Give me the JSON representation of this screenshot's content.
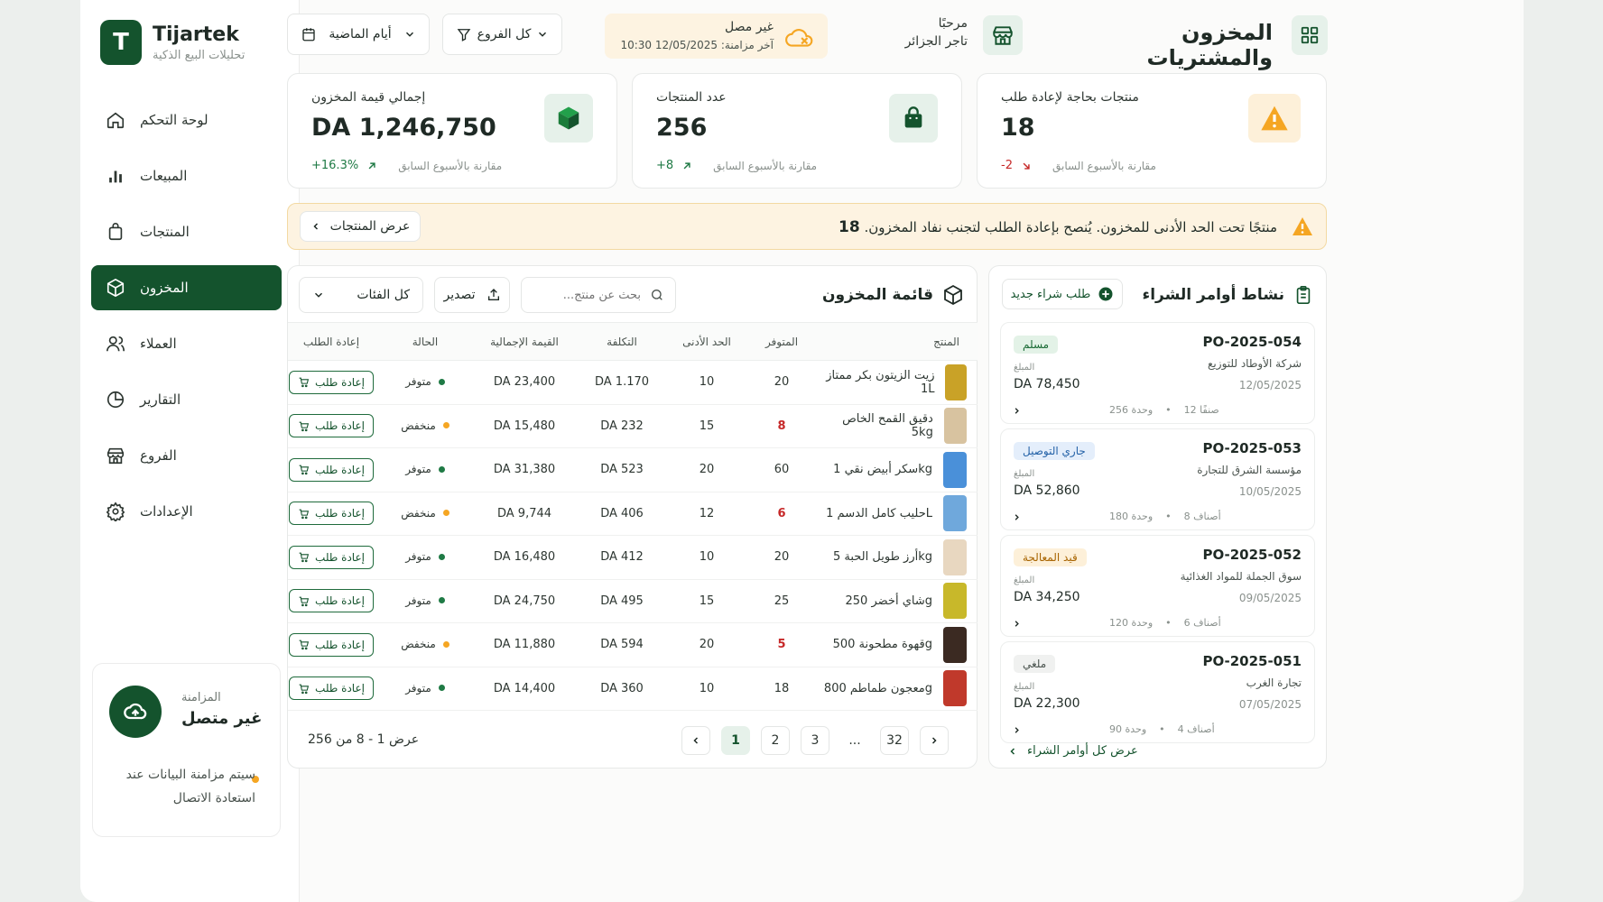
{
  "brand": {
    "name": "Tijartek",
    "tagline": "تحليلات البيع الذكية",
    "mark": "T"
  },
  "nav": [
    {
      "label": "لوحة التحكم",
      "icon": "home-icon"
    },
    {
      "label": "المبيعات",
      "icon": "bar-chart-icon"
    },
    {
      "label": "المنتجات",
      "icon": "shopping-bag-icon"
    },
    {
      "label": "المخزون",
      "icon": "box-icon",
      "active": true
    },
    {
      "label": "العملاء",
      "icon": "users-icon"
    },
    {
      "label": "التقارير",
      "icon": "pie-chart-icon"
    },
    {
      "label": "الفروع",
      "icon": "store-icon"
    },
    {
      "label": "الإعدادات",
      "icon": "gear-icon"
    }
  ],
  "sync": {
    "label": "المزامنة",
    "value": "غير متصل",
    "note": "سيتم مزامنة البيانات عند استعادة الاتصال"
  },
  "header": {
    "title": "المخزون والمشتريات",
    "welcome": "مرحبًا",
    "user": "تاجر الجزائر",
    "offline": "غير مصل",
    "last_sync": "آخر مزامنة: 12/05/2025 10:30",
    "branches": "كل الفروع",
    "period": "أيام الماضية"
  },
  "kpis": [
    {
      "label": "منتجات بحاجة لإعادة طلب",
      "value": "18",
      "delta": "-2",
      "compare": "مقارنة بالأسبوع السابق",
      "tone": "down"
    },
    {
      "label": "عدد المنتجات",
      "value": "256",
      "delta": "+8",
      "compare": "مقارنة بالأسبوع السابق",
      "tone": "up"
    },
    {
      "label": "إجمالي قيمة المخزون",
      "value": "DA 1,246,750",
      "delta": "+16.3%",
      "compare": "مقارنة بالأسبوع السابق",
      "tone": "up"
    }
  ],
  "alert": {
    "count": "18",
    "message": "منتجًا تحت الحد الأدنى للمخزون. يُنصح بإعادة الطلب لتجنب نفاد المخزون.",
    "button": "عرض المنتجات"
  },
  "inventory": {
    "title": "قائمة المخزون",
    "search_placeholder": "بحث عن منتج...",
    "export": "تصدير",
    "category": "كل الفئات",
    "columns": [
      "المنتج",
      "المتوفر",
      "الحد الأدنى",
      "التكلفة",
      "القيمة الإجمالية",
      "الحالة",
      "إعادة الطلب"
    ],
    "rows": [
      {
        "name": "زيت الزيتون بكر ممتاز 1L",
        "qty": "20",
        "min": "10",
        "cost": "DA 1.170",
        "total": "DA 23,400",
        "status": "متوفر",
        "state": "ok",
        "thumb": "#c9a227"
      },
      {
        "name": "دقيق القمح الخاص 5kg",
        "qty": "8",
        "min": "15",
        "cost": "DA 232",
        "total": "DA 15,480",
        "status": "منخفض",
        "state": "low",
        "thumb": "#d8c3a0"
      },
      {
        "name": "سكر أبيض نقي 1kg",
        "qty": "60",
        "min": "20",
        "cost": "DA 523",
        "total": "DA 31,380",
        "status": "متوفر",
        "state": "ok",
        "thumb": "#4a90d9"
      },
      {
        "name": "حليب كامل الدسم 1L",
        "qty": "6",
        "min": "12",
        "cost": "DA 406",
        "total": "DA 9,744",
        "status": "منخفض",
        "state": "low",
        "thumb": "#6fa8dc"
      },
      {
        "name": "أرز طويل الحبة 5kg",
        "qty": "20",
        "min": "10",
        "cost": "DA 412",
        "total": "DA 16,480",
        "status": "متوفر",
        "state": "ok",
        "thumb": "#e8d7c0"
      },
      {
        "name": "شاي أخضر 250g",
        "qty": "25",
        "min": "15",
        "cost": "DA 495",
        "total": "DA 24,750",
        "status": "متوفر",
        "state": "ok",
        "thumb": "#c8b82a"
      },
      {
        "name": "قهوة مطحونة 500g",
        "qty": "5",
        "min": "20",
        "cost": "DA 594",
        "total": "DA 11,880",
        "status": "منخفض",
        "state": "low",
        "thumb": "#3b2a22"
      },
      {
        "name": "معجون طماطم 800g",
        "qty": "18",
        "min": "10",
        "cost": "DA 360",
        "total": "DA 14,400",
        "status": "متوفر",
        "state": "ok",
        "thumb": "#c0392b"
      }
    ],
    "reorder_label": "إعادة طلب",
    "showing": "عرض 1 - 8 من 256",
    "pages": [
      "1",
      "2",
      "3",
      "...",
      "32"
    ]
  },
  "purchase": {
    "title": "نشاط أوامر الشراء",
    "new_button": "طلب شراء جديد",
    "amount_label": "المبلغ",
    "orders": [
      {
        "id": "PO-2025-054",
        "supplier": "شركة الأوطاد للتوزيع",
        "date": "12/05/2025",
        "status": "مسلم",
        "tone": "green",
        "amount": "DA 78,450",
        "items": "12 صنفًا",
        "units": "256 وحدة"
      },
      {
        "id": "PO-2025-053",
        "supplier": "مؤسسة الشرق للتجارة",
        "date": "10/05/2025",
        "status": "جاري التوصيل",
        "tone": "blue",
        "amount": "DA 52,860",
        "items": "8 أصناف",
        "units": "180 وحدة"
      },
      {
        "id": "PO-2025-052",
        "supplier": "سوق الجملة للمواد الغذائية",
        "date": "09/05/2025",
        "status": "قيد المعالجة",
        "tone": "amber",
        "amount": "DA 34,250",
        "items": "6 أصناف",
        "units": "120 وحدة"
      },
      {
        "id": "PO-2025-051",
        "supplier": "تجارة الغرب",
        "date": "07/05/2025",
        "status": "ملغي",
        "tone": "gray",
        "amount": "DA 22,300",
        "items": "4 أصناف",
        "units": "90 وحدة"
      }
    ],
    "view_all": "عرض كل أوامر الشراء"
  },
  "colors": {
    "primary": "#14532d",
    "warning": "#f5a623",
    "danger": "#c62828"
  }
}
